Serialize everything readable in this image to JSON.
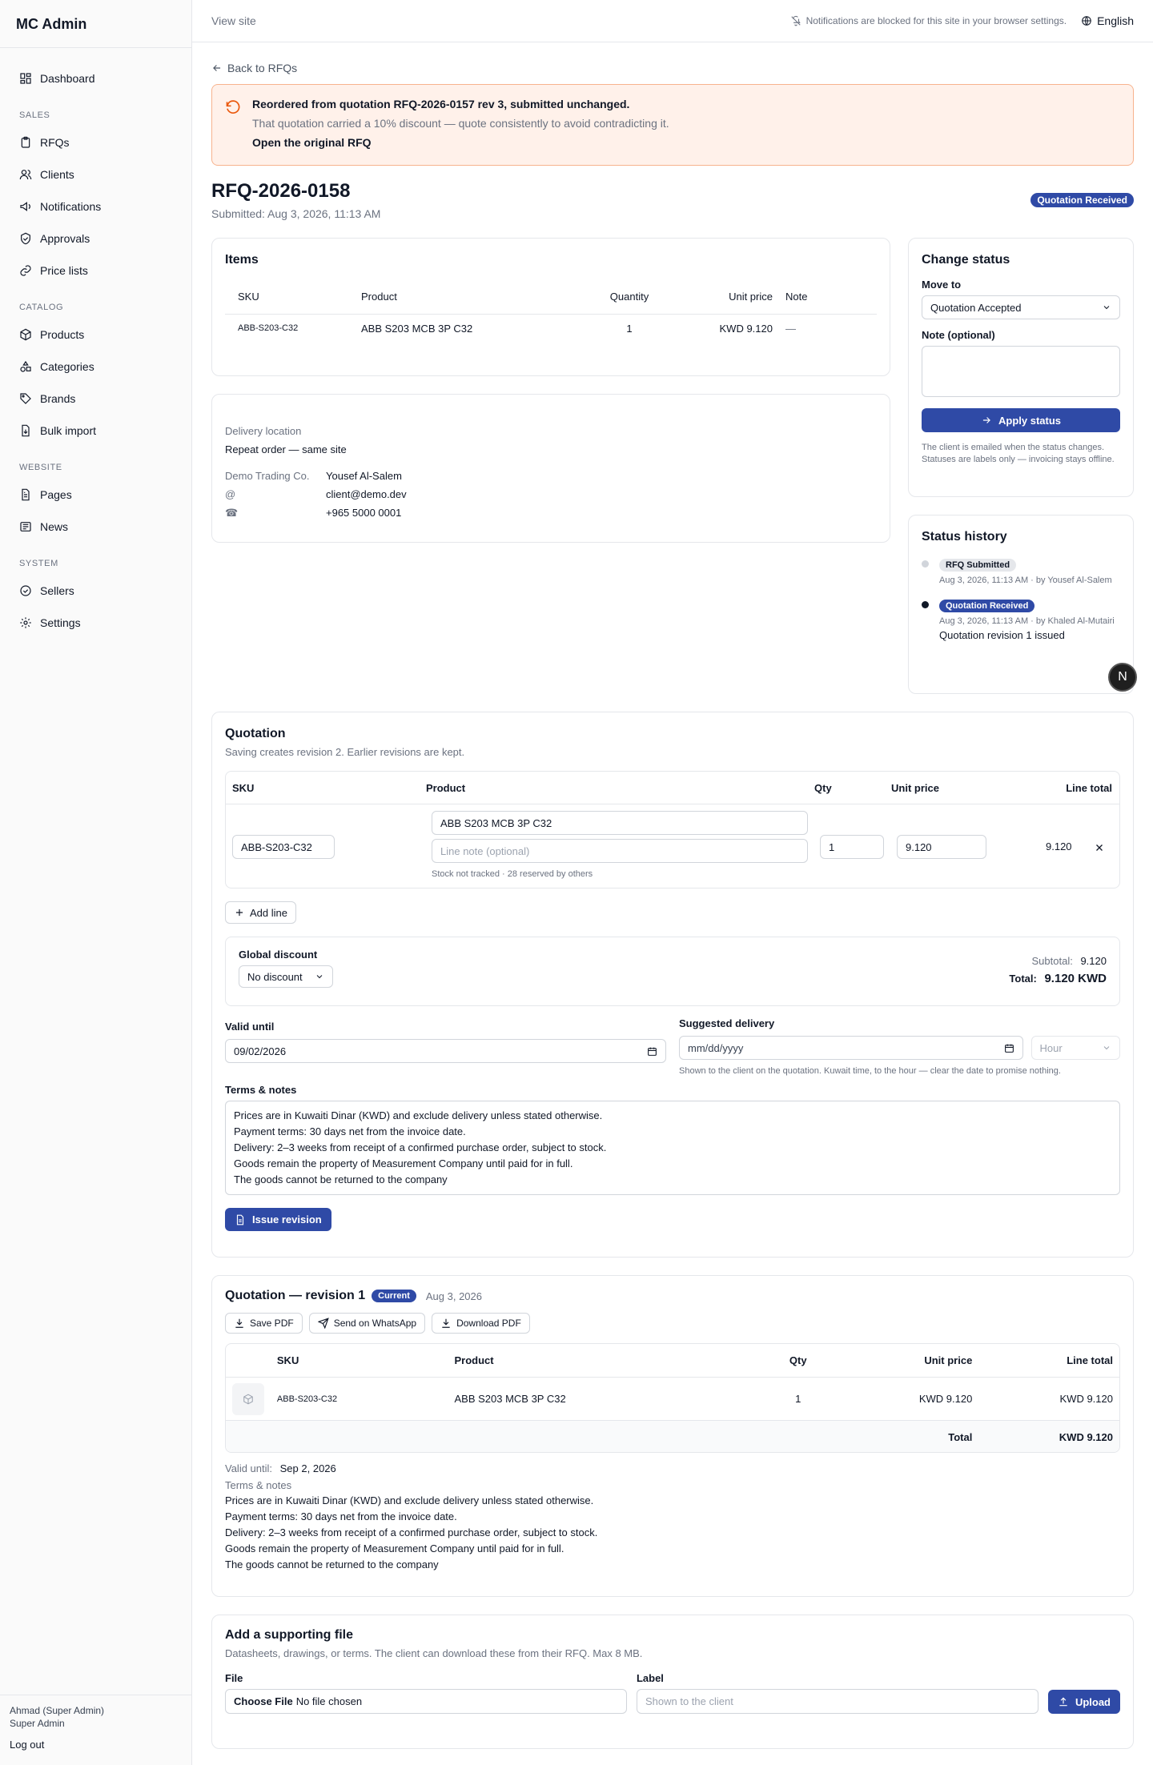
{
  "app": {
    "title": "MC Admin"
  },
  "sidebar": {
    "items": [
      {
        "label": "Dashboard",
        "icon": "dashboard-icon"
      },
      {
        "group": "SALES"
      },
      {
        "label": "RFQs",
        "icon": "clipboard-icon"
      },
      {
        "label": "Clients",
        "icon": "users-icon"
      },
      {
        "label": "Notifications",
        "icon": "megaphone-icon"
      },
      {
        "label": "Approvals",
        "icon": "shield-check-icon"
      },
      {
        "label": "Price lists",
        "icon": "link-icon"
      },
      {
        "group": "CATALOG"
      },
      {
        "label": "Products",
        "icon": "box-icon"
      },
      {
        "label": "Categories",
        "icon": "shapes-icon"
      },
      {
        "label": "Brands",
        "icon": "tag-icon"
      },
      {
        "label": "Bulk import",
        "icon": "file-import-icon"
      },
      {
        "group": "WEBSITE"
      },
      {
        "label": "Pages",
        "icon": "page-icon"
      },
      {
        "label": "News",
        "icon": "newspaper-icon"
      },
      {
        "group": "SYSTEM"
      },
      {
        "label": "Sellers",
        "icon": "badge-check-icon"
      },
      {
        "label": "Settings",
        "icon": "gear-icon"
      }
    ],
    "user_name": "Ahmad (Super Admin)",
    "user_role": "Super Admin",
    "logout_label": "Log out"
  },
  "topbar": {
    "view_site": "View site",
    "notif_blocked": "Notifications are blocked for this site in your browser settings.",
    "language": "English"
  },
  "page": {
    "back_label": "Back to RFQs",
    "alert": {
      "title": "Reordered from quotation RFQ-2026-0157 rev 3, submitted unchanged.",
      "body": "That quotation carried a 10% discount — quote consistently to avoid contradicting it.",
      "link": "Open the original RFQ"
    },
    "rfq_id": "RFQ-2026-0158",
    "submitted": "Submitted: Aug 3, 2026, 11:13 AM",
    "status_badge": "Quotation Received"
  },
  "items": {
    "title": "Items",
    "headers": [
      "SKU",
      "Product",
      "Quantity",
      "Unit price",
      "Note"
    ],
    "rows": [
      {
        "sku": "ABB-S203-C32",
        "product": "ABB S203 MCB 3P C32",
        "qty": "1",
        "price": "KWD 9.120",
        "note": "—"
      }
    ]
  },
  "delivery": {
    "label": "Delivery location",
    "value": "Repeat order — same site",
    "company": "Demo Trading Co.",
    "contact": "Yousef Al-Salem",
    "email_symbol": "@",
    "email": "client@demo.dev",
    "phone_symbol": "☎",
    "phone": "+965 5000 0001"
  },
  "change_status": {
    "title": "Change status",
    "move_to_label": "Move to",
    "move_to_value": "Quotation Accepted",
    "note_label": "Note (optional)",
    "apply_label": "Apply status",
    "help": "The client is emailed when the status changes. Statuses are labels only — invoicing stays offline."
  },
  "history": {
    "title": "Status history",
    "entries": [
      {
        "badge": "RFQ Submitted",
        "meta": "Aug 3, 2026, 11:13 AM · by Yousef Al-Salem",
        "note": ""
      },
      {
        "badge": "Quotation Received",
        "meta": "Aug 3, 2026, 11:13 AM · by Khaled Al-Mutairi",
        "note": "Quotation revision 1 issued"
      }
    ],
    "fab_label": "N"
  },
  "quotation_form": {
    "title": "Quotation",
    "subtitle": "Saving creates revision 2. Earlier revisions are kept.",
    "headers": [
      "SKU",
      "Product",
      "Qty",
      "Unit price",
      "Line total"
    ],
    "line": {
      "sku": "ABB-S203-C32",
      "product": "ABB S203 MCB 3P C32",
      "note_placeholder": "Line note (optional)",
      "stock": "Stock not tracked · 28 reserved by others",
      "qty": "1",
      "price": "9.120",
      "total": "9.120"
    },
    "add_line": "Add line",
    "discount_label": "Global discount",
    "discount_value": "No discount",
    "subtotal_label": "Subtotal:",
    "subtotal_value": "9.120",
    "total_label": "Total:",
    "total_value": "9.120 KWD",
    "valid_until_label": "Valid until",
    "valid_until_value": "09/02/2026",
    "suggested_label": "Suggested delivery",
    "suggested_placeholder": "mm/dd/yyyy",
    "hour_placeholder": "Hour",
    "suggested_help": "Shown to the client on the quotation. Kuwait time, to the hour — clear the date to promise nothing.",
    "terms_label": "Terms & notes",
    "terms_lines": [
      "Prices are in Kuwaiti Dinar (KWD) and exclude delivery unless stated otherwise.",
      "Payment terms: 30 days net from the invoice date.",
      "Delivery: 2–3 weeks from receipt of a confirmed purchase order, subject to stock.",
      "Goods remain the property of Measurement Company until paid for in full.",
      "The goods cannot be returned to the company"
    ],
    "issue_label": "Issue revision"
  },
  "revision": {
    "title": "Quotation — revision 1",
    "badge": "Current",
    "date": "Aug 3, 2026",
    "actions": [
      "Save PDF",
      "Send on WhatsApp",
      "Download PDF"
    ],
    "headers": [
      "SKU",
      "Product",
      "Qty",
      "Unit price",
      "Line total"
    ],
    "rows": [
      {
        "sku": "ABB-S203-C32",
        "product": "ABB S203 MCB 3P C32",
        "qty": "1",
        "price": "KWD 9.120",
        "total": "KWD 9.120"
      }
    ],
    "total_label": "Total",
    "total_value": "KWD 9.120",
    "valid_label": "Valid until:",
    "valid_value": "Sep 2, 2026",
    "terms_label": "Terms & notes",
    "terms_lines": [
      "Prices are in Kuwaiti Dinar (KWD) and exclude delivery unless stated otherwise.",
      "Payment terms: 30 days net from the invoice date.",
      "Delivery: 2–3 weeks from receipt of a confirmed purchase order, subject to stock.",
      "Goods remain the property of Measurement Company until paid for in full.",
      "The goods cannot be returned to the company"
    ]
  },
  "upload": {
    "title": "Add a supporting file",
    "subtitle": "Datasheets, drawings, or terms. The client can download these from their RFQ. Max 8 MB.",
    "file_label": "File",
    "choose_label": "Choose File",
    "no_file": "No file chosen",
    "label_label": "Label",
    "label_placeholder": "Shown to the client",
    "upload_button": "Upload"
  },
  "colors": {
    "accent": "#2f4aa6",
    "alert_bg": "#fff1ea",
    "alert_border": "#f7b38e"
  }
}
